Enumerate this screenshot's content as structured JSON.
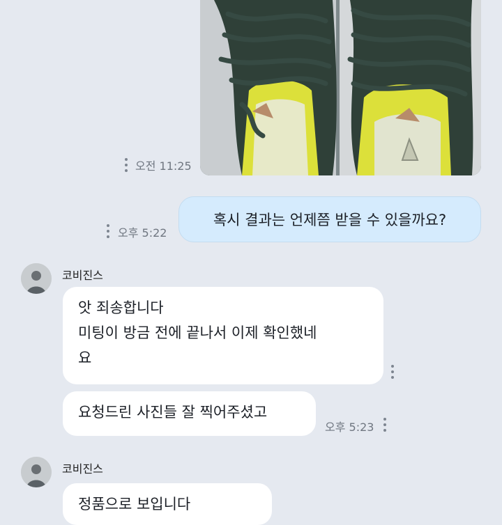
{
  "chat": {
    "msg1": {
      "type": "image",
      "alt_icon": "sneaker-photo",
      "time": "오전 11:25"
    },
    "msg2": {
      "type": "outgoing",
      "text": "혹시 결과는 언제쯤 받을 수 있을까요?",
      "time": "오후 5:22"
    },
    "group1": {
      "sender": "코비진스",
      "line1": "앗 죄송합니다",
      "line2": "미팅이 방금 전에 끝나서 이제 확인했네",
      "line3": "요",
      "line4": "요청드린 사진들 잘 찍어주셨고",
      "time": "오후 5:23"
    },
    "group2": {
      "sender": "코비진스",
      "partial_text": "정품으로 보입니다"
    }
  },
  "colors": {
    "background": "#e5e9f0",
    "outgoing_bubble": "#d5ebfd",
    "incoming_bubble": "#ffffff"
  }
}
